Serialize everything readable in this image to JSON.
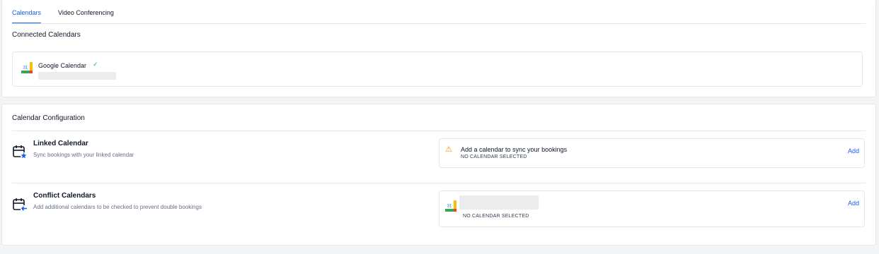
{
  "tabs": [
    {
      "label": "Calendars",
      "active": true
    },
    {
      "label": "Video Conferencing",
      "active": false
    }
  ],
  "connected": {
    "title": "Connected Calendars",
    "items": [
      {
        "name": "Google Calendar",
        "icon": "google-calendar-icon",
        "status_icon": "check-icon",
        "status_color": "#12b76a"
      }
    ]
  },
  "configuration": {
    "title": "Calendar Configuration",
    "linked": {
      "title": "Linked Calendar",
      "subtitle": "Sync bookings with your linked calendar",
      "icon": "calendar-star-icon",
      "selection": {
        "message": "Add a calendar to sync your bookings",
        "status": "NO CALENDAR SELECTED",
        "action": "Add",
        "warning_icon": "warning-icon"
      }
    },
    "conflict": {
      "title": "Conflict Calendars",
      "subtitle": "Add additional calendars to be checked to prevent double bookings",
      "icon": "calendar-arrow-icon",
      "selection": {
        "status": "NO CALENDAR SELECTED",
        "action": "Add",
        "account_icon": "google-calendar-icon"
      }
    }
  },
  "colors": {
    "accent": "#155eef",
    "success": "#12b76a",
    "warning": "#f79009"
  }
}
